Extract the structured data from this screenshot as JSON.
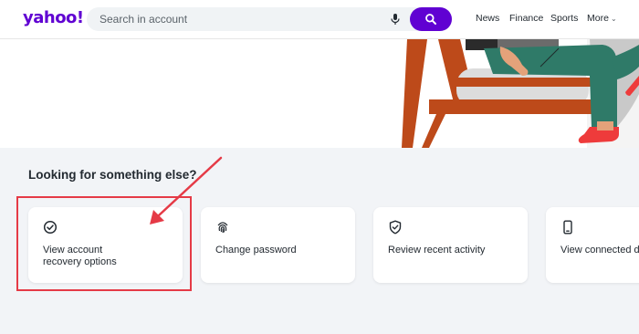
{
  "header": {
    "logo": "yahoo!",
    "search_placeholder": "Search in account",
    "nav": [
      "News",
      "Finance",
      "Sports",
      "More"
    ]
  },
  "section": {
    "title": "Looking for something else?"
  },
  "cards": [
    {
      "label": "View account\nrecovery options",
      "icon": "check-circle-icon"
    },
    {
      "label": "Change password",
      "icon": "fingerprint-icon"
    },
    {
      "label": "Review recent activity",
      "icon": "shield-check-icon"
    },
    {
      "label": "View connected d",
      "icon": "phone-icon"
    }
  ],
  "colors": {
    "brand": "#6001d2",
    "annotation": "#e53a46",
    "text": "#232a31"
  }
}
